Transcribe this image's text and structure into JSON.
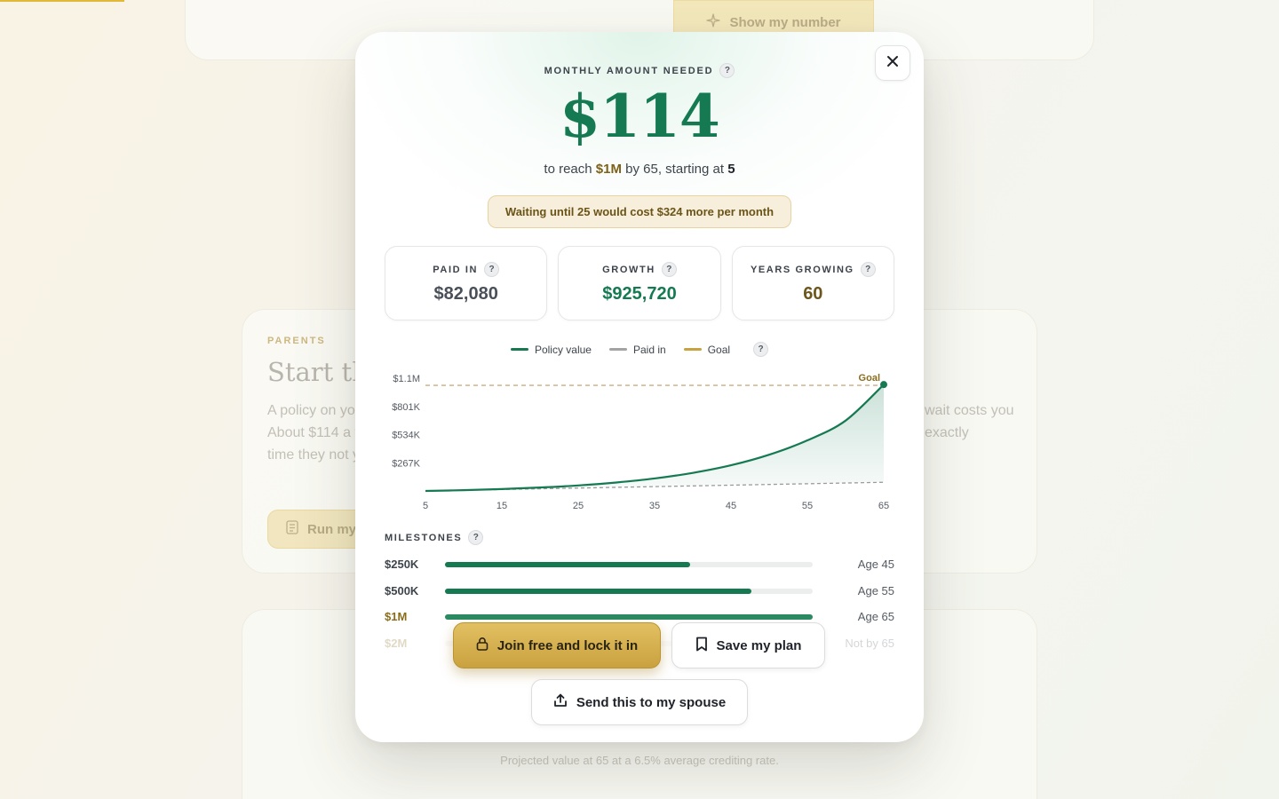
{
  "background": {
    "show_button_label": "Show my number",
    "parents_eyebrow": "PARENTS",
    "parents_title": "Start the",
    "parents_body": "A policy on yo About $114 a the time they not you.",
    "parents_body_right": "wait costs you exactly",
    "run_button_label": "Run my",
    "footnote": "Projected value at 65 at a 6.5% average crediting rate."
  },
  "modal": {
    "amount_label": "MONTHLY AMOUNT NEEDED",
    "amount": "$114",
    "subline": {
      "prefix": "to reach ",
      "target": "$1M",
      "mid": " by 65, starting at ",
      "start_age": "5"
    },
    "warning": "Waiting until 25 would cost $324 more per month",
    "stats": [
      {
        "label": "PAID IN",
        "value": "$82,080"
      },
      {
        "label": "GROWTH",
        "value": "$925,720"
      },
      {
        "label": "YEARS GROWING",
        "value": "60"
      }
    ],
    "legend": {
      "policy": "Policy value",
      "paid": "Paid in",
      "goal": "Goal"
    },
    "help_glyph": "?",
    "milestones_label": "MILESTONES",
    "milestones": [
      {
        "amount": "$250K",
        "progress": 0.667,
        "age": "Age 45"
      },
      {
        "amount": "$500K",
        "progress": 0.833,
        "age": "Age 55"
      },
      {
        "amount": "$1M",
        "progress": 1.0,
        "age": "Age 65"
      },
      {
        "amount": "$2M",
        "progress": 0,
        "age": "Not by 65"
      }
    ],
    "buttons": {
      "join": "Join free and lock it in",
      "save": "Save my plan",
      "send": "Send this to my spouse"
    }
  },
  "colors": {
    "accent_green": "#157a52",
    "gold": "#c9a240",
    "paid_gray": "#9a9a9a"
  },
  "chart_data": {
    "type": "line",
    "x": [
      5,
      10,
      15,
      20,
      25,
      30,
      35,
      40,
      45,
      50,
      55,
      60,
      65
    ],
    "series": [
      {
        "name": "Policy value",
        "values": [
          0,
          7500,
          18000,
          32500,
          52000,
          80000,
          118000,
          171000,
          243000,
          343000,
          479000,
          666000,
          1007800
        ]
      },
      {
        "name": "Paid in",
        "values": [
          0,
          6840,
          13680,
          20520,
          27360,
          34200,
          41040,
          47880,
          54720,
          61560,
          68400,
          75240,
          82080
        ]
      }
    ],
    "goal": {
      "label": "Goal",
      "value": 1000000
    },
    "y_ticks": [
      {
        "value": 267000,
        "label": "$267K"
      },
      {
        "value": 534000,
        "label": "$534K"
      },
      {
        "value": 801000,
        "label": "$801K"
      },
      {
        "value": 1068000,
        "label": "$1.1M"
      }
    ],
    "x_ticks": [
      5,
      15,
      25,
      35,
      45,
      55,
      65
    ],
    "xlim": [
      5,
      65
    ],
    "ylim": [
      0,
      1068000
    ],
    "grid": false,
    "legend_position": "top-center"
  }
}
